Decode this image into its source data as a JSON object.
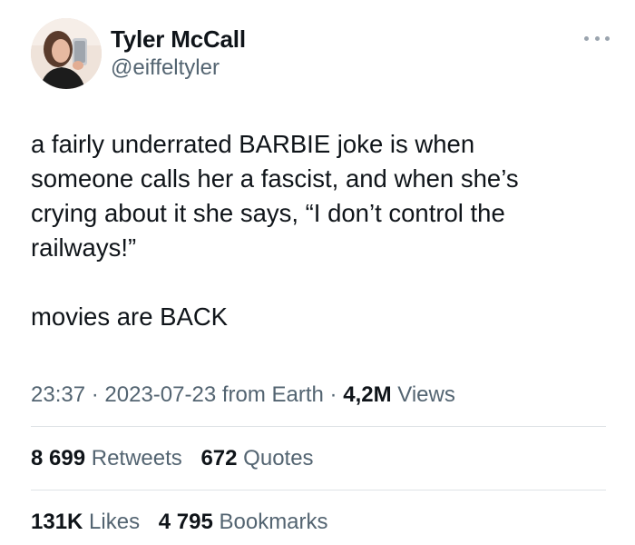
{
  "author": {
    "display_name": "Tyler McCall",
    "handle": "@eiffeltyler",
    "avatar_icon": "profile-photo"
  },
  "more_icon": "ellipsis-icon",
  "tweet": {
    "text": "a fairly underrated BARBIE joke is when\nsomeone calls her a fascist, and when she’s\ncrying about it she says, “I don’t control the\nrailways!”\n\nmovies are BACK"
  },
  "meta": {
    "time": "23:37",
    "separator": "·",
    "date": "2023-07-23",
    "source": "from Earth",
    "views_count": "4,2M",
    "views_label": "Views"
  },
  "stats": {
    "retweets": {
      "count": "8 699",
      "label": "Retweets"
    },
    "quotes": {
      "count": "672",
      "label": "Quotes"
    },
    "likes": {
      "count": "131K",
      "label": "Likes"
    },
    "bookmarks": {
      "count": "4 795",
      "label": "Bookmarks"
    }
  },
  "colors": {
    "text_primary": "#0f1419",
    "text_secondary": "#536471",
    "divider": "#dfe3e6"
  }
}
